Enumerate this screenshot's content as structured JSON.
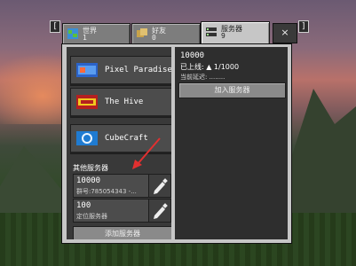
{
  "tabs": {
    "left_key": "[",
    "right_key": "]",
    "worlds": {
      "label": "世界",
      "count": "1"
    },
    "friends": {
      "label": "好友",
      "count": "0"
    },
    "servers": {
      "label": "服务器",
      "count": "9"
    },
    "close_label": "×"
  },
  "featured_servers": [
    {
      "name": "Pixel Paradise"
    },
    {
      "name": "The Hive"
    },
    {
      "name": "CubeCraft"
    }
  ],
  "other_servers": {
    "section_label": "其他服务器",
    "items": [
      {
        "address": "10000",
        "detail": "群号:785054343 -..."
      },
      {
        "address": "100",
        "detail": "定位服务器"
      }
    ],
    "add_label": "添加服务器"
  },
  "details": {
    "address": "10000",
    "online": "已上线: ▲ 1/1000",
    "latency": "当前延迟: ........",
    "join_label": "加入服务器"
  }
}
